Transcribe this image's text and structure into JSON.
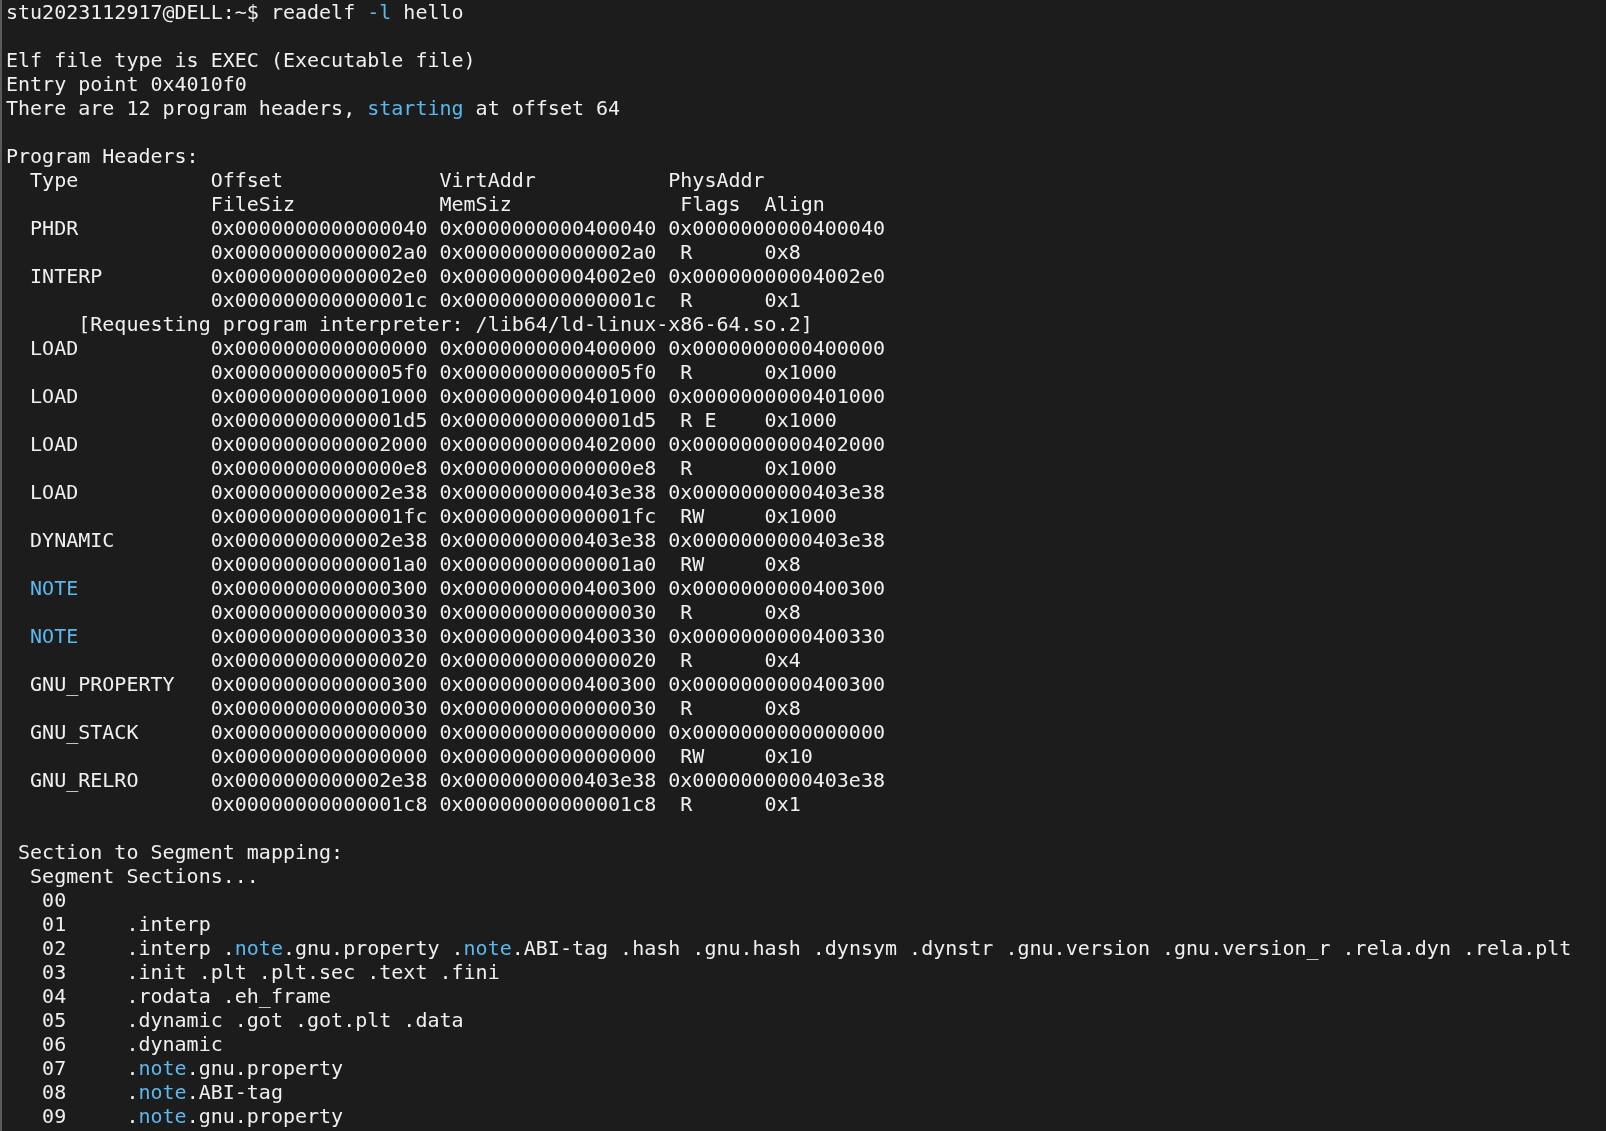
{
  "terminal": {
    "lines": [
      {
        "kind": "mixed",
        "segments": [
          {
            "text": "stu2023112917@DELL:~$ readelf ",
            "kind": "plain"
          },
          {
            "text": "-l",
            "kind": "keyword"
          },
          {
            "text": " hello",
            "kind": "plain"
          }
        ]
      },
      {
        "kind": "blank"
      },
      {
        "kind": "text",
        "text": "Elf file type is EXEC (Executable file)"
      },
      {
        "kind": "text",
        "text": "Entry point 0x4010f0"
      },
      {
        "kind": "mixed",
        "segments": [
          {
            "text": "There are 12 program headers, ",
            "kind": "plain"
          },
          {
            "text": "starting",
            "kind": "keyword"
          },
          {
            "text": " at offset 64",
            "kind": "plain"
          }
        ]
      },
      {
        "kind": "blank"
      },
      {
        "kind": "text",
        "text": "Program Headers:"
      },
      {
        "kind": "text",
        "text": "  Type           Offset             VirtAddr           PhysAddr"
      },
      {
        "kind": "text",
        "text": "                 FileSiz            MemSiz              Flags  Align"
      },
      {
        "kind": "text",
        "text": "  PHDR           0x0000000000000040 0x0000000000400040 0x0000000000400040"
      },
      {
        "kind": "text",
        "text": "                 0x00000000000002a0 0x00000000000002a0  R      0x8"
      },
      {
        "kind": "text",
        "text": "  INTERP         0x00000000000002e0 0x00000000004002e0 0x00000000004002e0"
      },
      {
        "kind": "text",
        "text": "                 0x000000000000001c 0x000000000000001c  R      0x1"
      },
      {
        "kind": "text",
        "text": "      [Requesting program interpreter: /lib64/ld-linux-x86-64.so.2]"
      },
      {
        "kind": "text",
        "text": "  LOAD           0x0000000000000000 0x0000000000400000 0x0000000000400000"
      },
      {
        "kind": "text",
        "text": "                 0x00000000000005f0 0x00000000000005f0  R      0x1000"
      },
      {
        "kind": "text",
        "text": "  LOAD           0x0000000000001000 0x0000000000401000 0x0000000000401000"
      },
      {
        "kind": "text",
        "text": "                 0x00000000000001d5 0x00000000000001d5  R E    0x1000"
      },
      {
        "kind": "text",
        "text": "  LOAD           0x0000000000002000 0x0000000000402000 0x0000000000402000"
      },
      {
        "kind": "text",
        "text": "                 0x00000000000000e8 0x00000000000000e8  R      0x1000"
      },
      {
        "kind": "text",
        "text": "  LOAD           0x0000000000002e38 0x0000000000403e38 0x0000000000403e38"
      },
      {
        "kind": "text",
        "text": "                 0x00000000000001fc 0x00000000000001fc  RW     0x1000"
      },
      {
        "kind": "text",
        "text": "  DYNAMIC        0x0000000000002e38 0x0000000000403e38 0x0000000000403e38"
      },
      {
        "kind": "text",
        "text": "                 0x00000000000001a0 0x00000000000001a0  RW     0x8"
      },
      {
        "kind": "mixed",
        "segments": [
          {
            "text": "  NOTE",
            "kind": "keyword"
          },
          {
            "text": "           0x0000000000000300 0x0000000000400300 0x0000000000400300",
            "kind": "plain"
          }
        ]
      },
      {
        "kind": "text",
        "text": "                 0x0000000000000030 0x0000000000000030  R      0x8"
      },
      {
        "kind": "mixed",
        "segments": [
          {
            "text": "  NOTE",
            "kind": "keyword"
          },
          {
            "text": "           0x0000000000000330 0x0000000000400330 0x0000000000400330",
            "kind": "plain"
          }
        ]
      },
      {
        "kind": "text",
        "text": "                 0x0000000000000020 0x0000000000000020  R      0x4"
      },
      {
        "kind": "text",
        "text": "  GNU_PROPERTY   0x0000000000000300 0x0000000000400300 0x0000000000400300"
      },
      {
        "kind": "text",
        "text": "                 0x0000000000000030 0x0000000000000030  R      0x8"
      },
      {
        "kind": "text",
        "text": "  GNU_STACK      0x0000000000000000 0x0000000000000000 0x0000000000000000"
      },
      {
        "kind": "text",
        "text": "                 0x0000000000000000 0x0000000000000000  RW     0x10"
      },
      {
        "kind": "text",
        "text": "  GNU_RELRO      0x0000000000002e38 0x0000000000403e38 0x0000000000403e38"
      },
      {
        "kind": "text",
        "text": "                 0x00000000000001c8 0x00000000000001c8  R      0x1"
      },
      {
        "kind": "blank"
      },
      {
        "kind": "text",
        "text": " Section to Segment mapping:"
      },
      {
        "kind": "text",
        "text": "  Segment Sections..."
      },
      {
        "kind": "text",
        "text": "   00"
      },
      {
        "kind": "text",
        "text": "   01     .interp"
      },
      {
        "kind": "mixed",
        "segments": [
          {
            "text": "   02     .interp .",
            "kind": "plain"
          },
          {
            "text": "note",
            "kind": "keyword"
          },
          {
            "text": ".gnu.property .",
            "kind": "plain"
          },
          {
            "text": "note",
            "kind": "keyword"
          },
          {
            "text": ".ABI-tag .hash .gnu.hash .dynsym .dynstr .gnu.version .gnu.version_r .rela.dyn .rela.plt",
            "kind": "plain"
          }
        ]
      },
      {
        "kind": "text",
        "text": "   03     .init .plt .plt.sec .text .fini"
      },
      {
        "kind": "text",
        "text": "   04     .rodata .eh_frame"
      },
      {
        "kind": "text",
        "text": "   05     .dynamic .got .got.plt .data"
      },
      {
        "kind": "text",
        "text": "   06     .dynamic"
      },
      {
        "kind": "mixed",
        "segments": [
          {
            "text": "   07     .",
            "kind": "plain"
          },
          {
            "text": "note",
            "kind": "keyword"
          },
          {
            "text": ".gnu.property",
            "kind": "plain"
          }
        ]
      },
      {
        "kind": "mixed",
        "segments": [
          {
            "text": "   08     .",
            "kind": "plain"
          },
          {
            "text": "note",
            "kind": "keyword"
          },
          {
            "text": ".ABI-tag",
            "kind": "plain"
          }
        ]
      },
      {
        "kind": "mixed",
        "segments": [
          {
            "text": "   09     .",
            "kind": "plain"
          },
          {
            "text": "note",
            "kind": "keyword"
          },
          {
            "text": ".gnu.property",
            "kind": "plain"
          }
        ]
      }
    ]
  }
}
